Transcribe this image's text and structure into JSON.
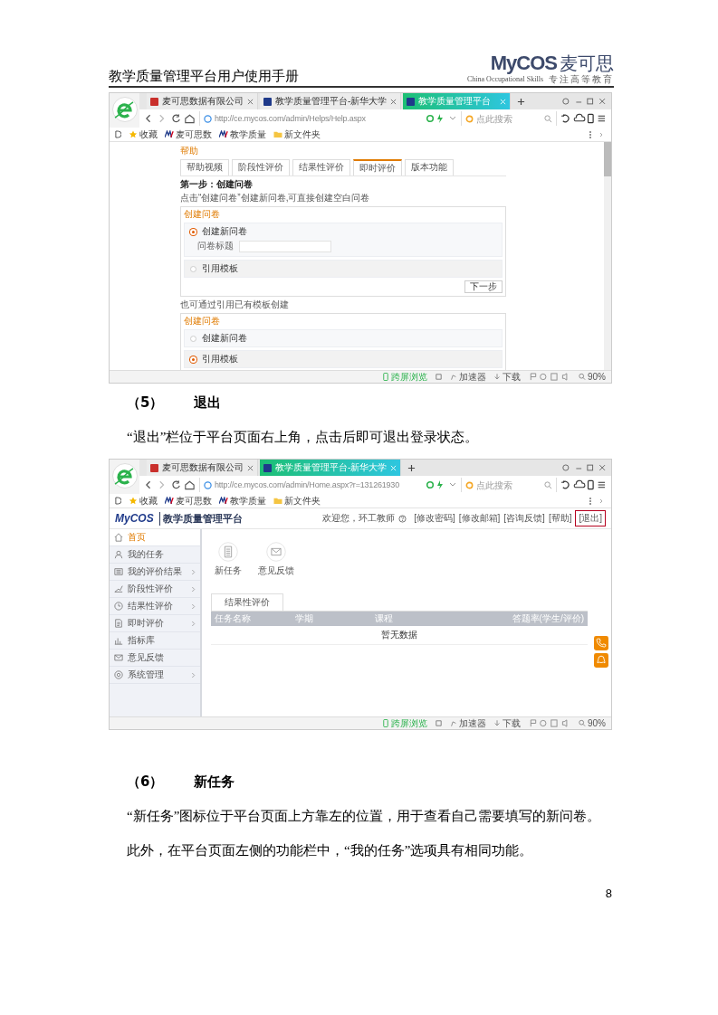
{
  "header": {
    "title": "教学质量管理平台用户使用手册",
    "logo": "MyCOS",
    "logo_cn": "麦可思",
    "logo_tagline": "China Occupational Skills",
    "logo_slogan": "专注高等教育"
  },
  "blocks": [
    {
      "kind": "browser",
      "tabs": [
        {
          "label": "麦可思数据有限公司",
          "selected": false
        },
        {
          "label": "教学质量管理平台-新华大学",
          "selected": false
        },
        {
          "label": "教学质量管理平台",
          "selected": true
        }
      ],
      "url": "http://ce.mycos.com/admin/Helps/Help.aspx",
      "search_placeholder": "点此搜索",
      "bookmarks": [
        "收藏",
        "麦可思数",
        "教学质量",
        "新文件夹"
      ],
      "status": {
        "cross": "跨屏浏览",
        "accel": "加速器",
        "download": "下载",
        "zoom": "90%"
      },
      "content": {
        "kind": "help",
        "title": "帮助",
        "tabs": [
          {
            "label": "帮助视频",
            "selected": false
          },
          {
            "label": "阶段性评价",
            "selected": false
          },
          {
            "label": "结果性评价",
            "selected": false
          },
          {
            "label": "即时评价",
            "selected": true
          },
          {
            "label": "版本功能",
            "selected": false
          }
        ],
        "step": "第一步：创建问卷",
        "note": "点击“创建问卷”创建新问卷,可直接创建空白问卷",
        "panels": [
          {
            "title": "创建问卷",
            "options": [
              {
                "label": "创建新问卷",
                "selected": true,
                "field_label": "问卷标题"
              },
              {
                "label": "引用模板",
                "selected": false
              }
            ],
            "button": "下一步"
          },
          {
            "note": "也可通过引用已有模板创建",
            "title": "创建问卷",
            "options": [
              {
                "label": "创建新问卷",
                "selected": false
              },
              {
                "label": "引用模板",
                "selected": true
              }
            ]
          }
        ]
      }
    },
    {
      "kind": "heading",
      "number": "（5）",
      "title": "退出"
    },
    {
      "kind": "paragraph",
      "text": "“退出”栏位于平台页面右上角，点击后即可退出登录状态。"
    },
    {
      "kind": "browser",
      "tabs": [
        {
          "label": "麦可思数据有限公司",
          "selected": false
        },
        {
          "label": "教学质量管理平台-新华大学",
          "selected": true
        }
      ],
      "url": "http://ce.mycos.com/admin/Home.aspx?r=131261930",
      "search_placeholder": "点此搜索",
      "bookmarks": [
        "收藏",
        "麦可思数",
        "教学质量",
        "新文件夹"
      ],
      "status": {
        "cross": "跨屏浏览",
        "accel": "加速器",
        "download": "下载",
        "zoom": "90%"
      },
      "content": {
        "kind": "home",
        "brand": "MyCOS",
        "platform": "教学质量管理平台",
        "welcome": "欢迎您，环工教师",
        "links": [
          {
            "label": "[修改密码]",
            "highlighted": false
          },
          {
            "label": "[修改邮箱]",
            "highlighted": false
          },
          {
            "label": "[咨询反馈]",
            "highlighted": false
          },
          {
            "label": "[帮助]",
            "highlighted": false
          },
          {
            "label": "[退出]",
            "highlighted": true
          }
        ],
        "sidebar": [
          {
            "label": "首页",
            "selected": true,
            "expandable": false
          },
          {
            "label": "我的任务",
            "selected": false,
            "expandable": false
          },
          {
            "label": "我的评价结果",
            "selected": false,
            "expandable": true
          },
          {
            "label": "阶段性评价",
            "selected": false,
            "expandable": true
          },
          {
            "label": "结果性评价",
            "selected": false,
            "expandable": true
          },
          {
            "label": "即时评价",
            "selected": false,
            "expandable": true
          },
          {
            "label": "指标库",
            "selected": false,
            "expandable": false
          },
          {
            "label": "意见反馈",
            "selected": false,
            "expandable": false
          },
          {
            "label": "系统管理",
            "selected": false,
            "expandable": true
          }
        ],
        "shortcuts": [
          "新任务",
          "意见反馈"
        ],
        "table_tab": "结果性评价",
        "columns": [
          "任务名称",
          "学期",
          "课程",
          "答题率(学生/评价)"
        ],
        "empty": "暂无数据"
      }
    },
    {
      "kind": "heading",
      "number": "（6）",
      "title": "新任务"
    },
    {
      "kind": "paragraph",
      "text": "“新任务”图标位于平台页面上方靠左的位置，用于查看自己需要填写的新问卷。"
    },
    {
      "kind": "paragraph",
      "text": "此外，在平台页面左侧的功能栏中，“我的任务”选项具有相同功能。"
    }
  ],
  "page_number": "8"
}
